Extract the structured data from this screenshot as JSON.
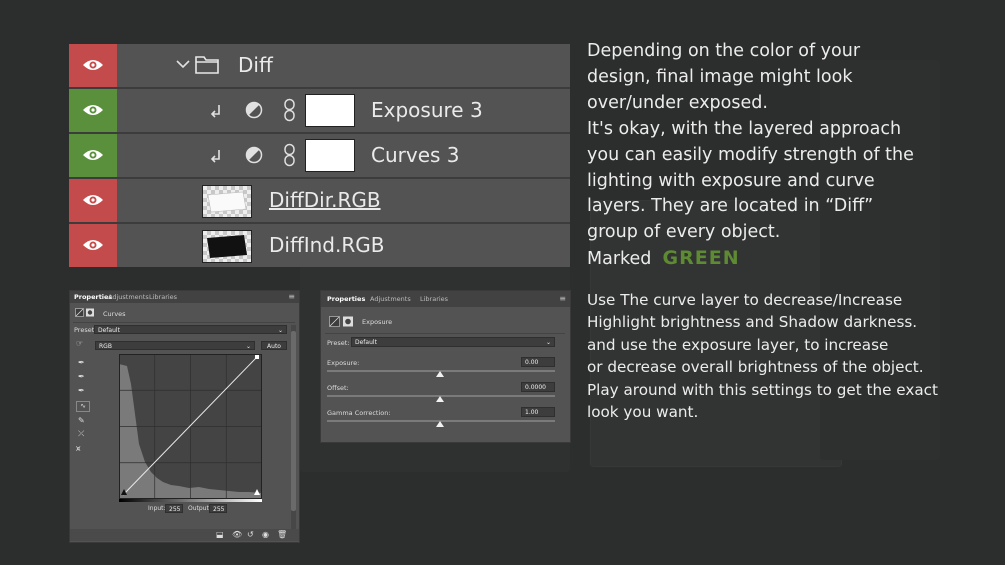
{
  "layers": [
    {
      "name": "Diff",
      "eye": "red",
      "type": "group"
    },
    {
      "name": "Exposure 3",
      "eye": "green",
      "type": "adjustment"
    },
    {
      "name": "Curves 3",
      "eye": "green",
      "type": "adjustment"
    },
    {
      "name": "DiffDir.RGB",
      "eye": "red",
      "type": "layer"
    },
    {
      "name": "DiffInd.RGB",
      "eye": "red",
      "type": "layer"
    }
  ],
  "colors": {
    "eye_red": "#c44b4b",
    "eye_green": "#5a8f3c",
    "green_text": "#5e8a34"
  },
  "text1": {
    "lines": [
      "Depending on the color of your",
      "design, final image might look",
      "over/under exposed.",
      "It's okay, with the layered approach",
      "you can easily modify strength of the",
      "lighting with exposure and curve",
      "layers. They are located in “Diff”",
      "group of every object."
    ],
    "marked": "Marked",
    "green": "GREEN"
  },
  "text2": {
    "lines": [
      "Use The curve layer to decrease/Increase",
      "Highlight brightness and Shadow darkness.",
      "and use the exposure layer, to increase",
      "or decrease overall brightness of the object.",
      "Play around with this settings to get the exact",
      "look you want."
    ]
  },
  "curves_panel": {
    "tabs": [
      "Properties",
      "Adjustments",
      "Libraries"
    ],
    "title": "Curves",
    "preset_label": "Preset:",
    "preset_value": "Default",
    "channel": "RGB",
    "auto": "Auto",
    "input_label": "Input:",
    "input_value": "255",
    "output_label": "Output:",
    "output_value": "255"
  },
  "exposure_panel": {
    "tabs": [
      "Properties",
      "Adjustments",
      "Libraries"
    ],
    "title": "Exposure",
    "preset_label": "Preset:",
    "preset_value": "Default",
    "exposure_label": "Exposure:",
    "exposure_value": "0.00",
    "offset_label": "Offset:",
    "offset_value": "0.0000",
    "gamma_label": "Gamma Correction:",
    "gamma_value": "1.00"
  }
}
